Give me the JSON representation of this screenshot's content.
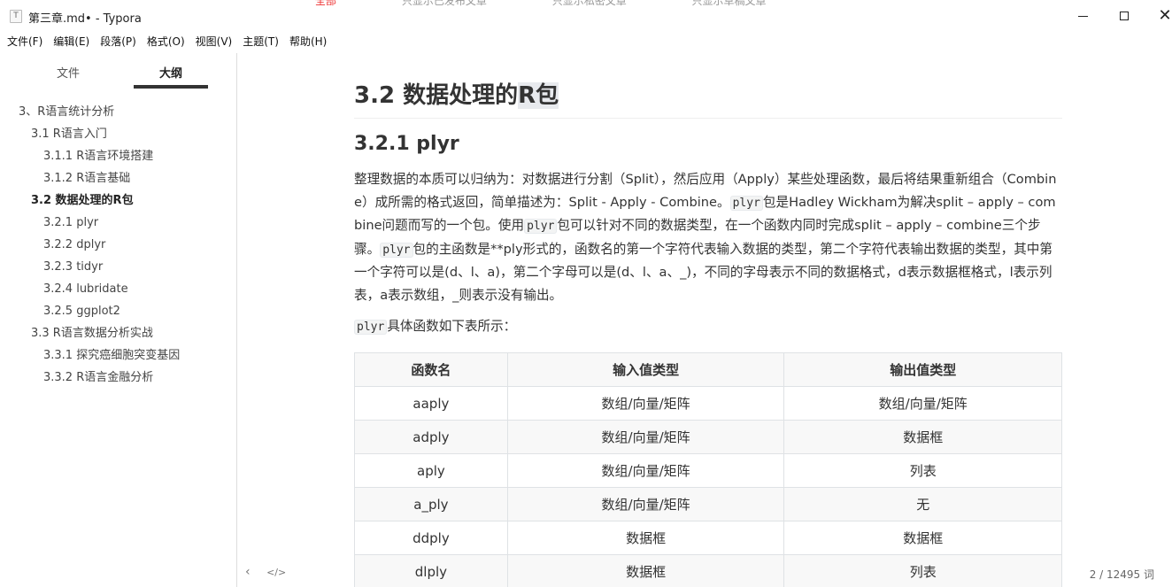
{
  "window": {
    "title": "第三章.md• - Typora",
    "app_icon": "T",
    "background_tabs": [
      "全部",
      "只显示已发布文章",
      "只显示私密文章",
      "只显示草稿文章"
    ]
  },
  "menu": [
    "文件(F)",
    "编辑(E)",
    "段落(P)",
    "格式(O)",
    "视图(V)",
    "主题(T)",
    "帮助(H)"
  ],
  "sidebar": {
    "tabs": [
      "文件",
      "大纲"
    ],
    "active_tab": "大纲",
    "outline": [
      {
        "label": "3、R语言统计分析",
        "level": 1
      },
      {
        "label": "3.1 R语言入门",
        "level": 2
      },
      {
        "label": "3.1.1 R语言环境搭建",
        "level": 3
      },
      {
        "label": "3.1.2 R语言基础",
        "level": 3
      },
      {
        "label": "3.2 数据处理的R包",
        "level": 2,
        "active": true
      },
      {
        "label": "3.2.1 plyr",
        "level": 3
      },
      {
        "label": "3.2.2 dplyr",
        "level": 3
      },
      {
        "label": "3.2.3 tidyr",
        "level": 3
      },
      {
        "label": "3.2.4 lubridate",
        "level": 3
      },
      {
        "label": "3.2.5 ggplot2",
        "level": 3
      },
      {
        "label": "3.3 R语言数据分析实战",
        "level": 2
      },
      {
        "label": "3.3.1 探究癌细胞突变基因",
        "level": 3
      },
      {
        "label": "3.3.2 R语言金融分析",
        "level": 3
      }
    ]
  },
  "document": {
    "h1_prefix": "3.2 数据处理的",
    "h1_highlight": "R包",
    "h2": "3.2.1 plyr",
    "paragraph1": [
      {
        "t": "text",
        "v": "整理数据的本质可以归纳为：对数据进行分割（Split），然后应用（Apply）某些处理函数，最后将结果重新组合（Combine）成所需的格式返回，简单描述为：Split - Apply - Combine。"
      },
      {
        "t": "code",
        "v": "plyr"
      },
      {
        "t": "text",
        "v": "包是Hadley Wickham为解决split – apply – combine问题而写的一个包。使用"
      },
      {
        "t": "code",
        "v": "plyr"
      },
      {
        "t": "text",
        "v": "包可以针对不同的数据类型，在一个函数内同时完成split – apply – combine三个步骤。"
      },
      {
        "t": "code",
        "v": "plyr"
      },
      {
        "t": "text",
        "v": "包的主函数是**ply形式的，函数名的第一个字符代表输入数据的类型，第二个字符代表输出数据的类型，其中第一个字符可以是(d、l、a)，第二个字母可以是(d、l、a、_)，不同的字母表示不同的数据格式，d表示数据框格式，l表示列表，a表示数组，_则表示没有输出。"
      }
    ],
    "paragraph2_code": "plyr",
    "paragraph2_text": "具体函数如下表所示：",
    "table": {
      "headers": [
        "函数名",
        "输入值类型",
        "输出值类型"
      ],
      "rows": [
        [
          "aaply",
          "数组/向量/矩阵",
          "数组/向量/矩阵"
        ],
        [
          "adply",
          "数组/向量/矩阵",
          "数据框"
        ],
        [
          "aply",
          "数组/向量/矩阵",
          "列表"
        ],
        [
          "a_ply",
          "数组/向量/矩阵",
          "无"
        ],
        [
          "ddply",
          "数据框",
          "数据框"
        ],
        [
          "dlply",
          "数据框",
          "列表"
        ]
      ]
    }
  },
  "footer": {
    "prev_symbol": "‹",
    "source_symbol": "</>",
    "word_count": "2 / 12495 词"
  }
}
